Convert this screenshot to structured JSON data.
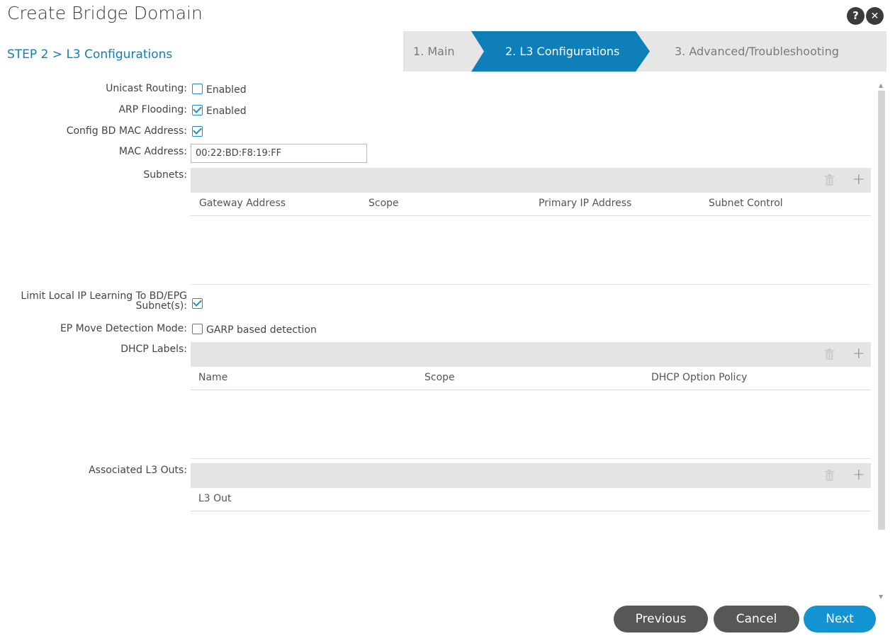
{
  "header": {
    "title": "Create Bridge Domain",
    "help_glyph": "?",
    "close_glyph": "✕"
  },
  "step": {
    "title": "STEP 2 > L3 Configurations"
  },
  "wizard": {
    "steps": [
      {
        "label": "1. Main",
        "active": false
      },
      {
        "label": "2. L3 Configurations",
        "active": true
      },
      {
        "label": "3. Advanced/Troubleshooting",
        "active": false
      }
    ],
    "active_color": "#0e7fb8"
  },
  "form": {
    "unicast_routing": {
      "label": "Unicast Routing:",
      "option": "Enabled",
      "checked": false
    },
    "arp_flooding": {
      "label": "ARP Flooding:",
      "option": "Enabled",
      "checked": true
    },
    "config_bd_mac": {
      "label": "Config BD MAC Address:",
      "checked": true
    },
    "mac_address": {
      "label": "MAC Address:",
      "value": "00:22:BD:F8:19:FF"
    },
    "subnets": {
      "label": "Subnets:",
      "columns": [
        "Gateway Address",
        "Scope",
        "Primary IP Address",
        "Subnet Control"
      ]
    },
    "limit_local_ip": {
      "label_line1": "Limit Local IP Learning To BD/EPG",
      "label_line2": "Subnet(s):",
      "checked": true
    },
    "ep_move": {
      "label": "EP Move Detection Mode:",
      "option": "GARP based detection",
      "checked": false
    },
    "dhcp_labels": {
      "label": "DHCP Labels:",
      "columns": [
        "Name",
        "Scope",
        "DHCP Option Policy"
      ]
    },
    "l3_outs": {
      "label": "Associated L3 Outs:",
      "columns": [
        "L3 Out"
      ]
    }
  },
  "icons": {
    "plus_glyph": "+"
  },
  "buttons": {
    "previous": "Previous",
    "cancel": "Cancel",
    "next": "Next"
  },
  "colors": {
    "accent": "#0e7fb8",
    "next_button": "#1393d1",
    "secondary_button": "#575757"
  }
}
